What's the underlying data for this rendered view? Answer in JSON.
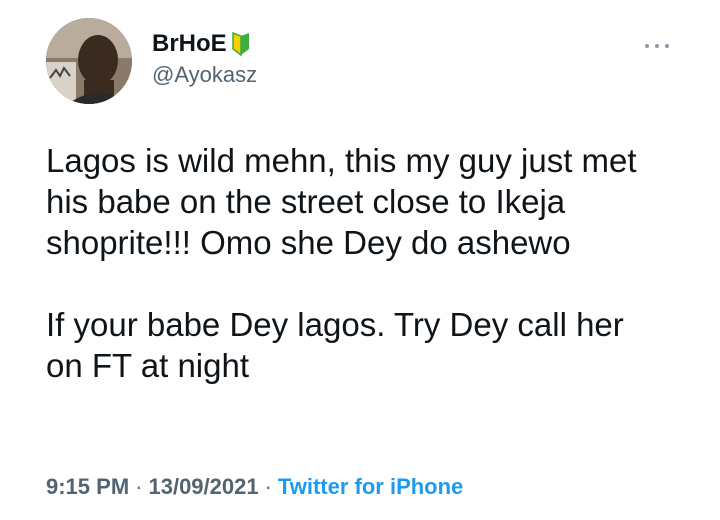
{
  "author": {
    "display_name": "BrHoE",
    "handle": "@Ayokasz",
    "badge_icon": "beginner-shield-icon",
    "avatar_icon": "profile-photo-avatar"
  },
  "menu": {
    "more_icon": "more-options-icon"
  },
  "tweet": {
    "paragraph_1": "Lagos is wild mehn, this my guy just met\nhis babe on the street close to Ikeja\nshoprite!!! Omo she Dey do ashewo",
    "paragraph_2": "If your babe Dey lagos. Try Dey call her\non FT at night"
  },
  "meta": {
    "time": "9:15 PM",
    "separator": "·",
    "date": "13/09/2021",
    "source": "Twitter for iPhone"
  },
  "colors": {
    "text": "#0f1419",
    "secondary": "#536471",
    "link": "#1d9bf0",
    "badge_green": "#3cae3c",
    "badge_yellow": "#f4d000"
  }
}
